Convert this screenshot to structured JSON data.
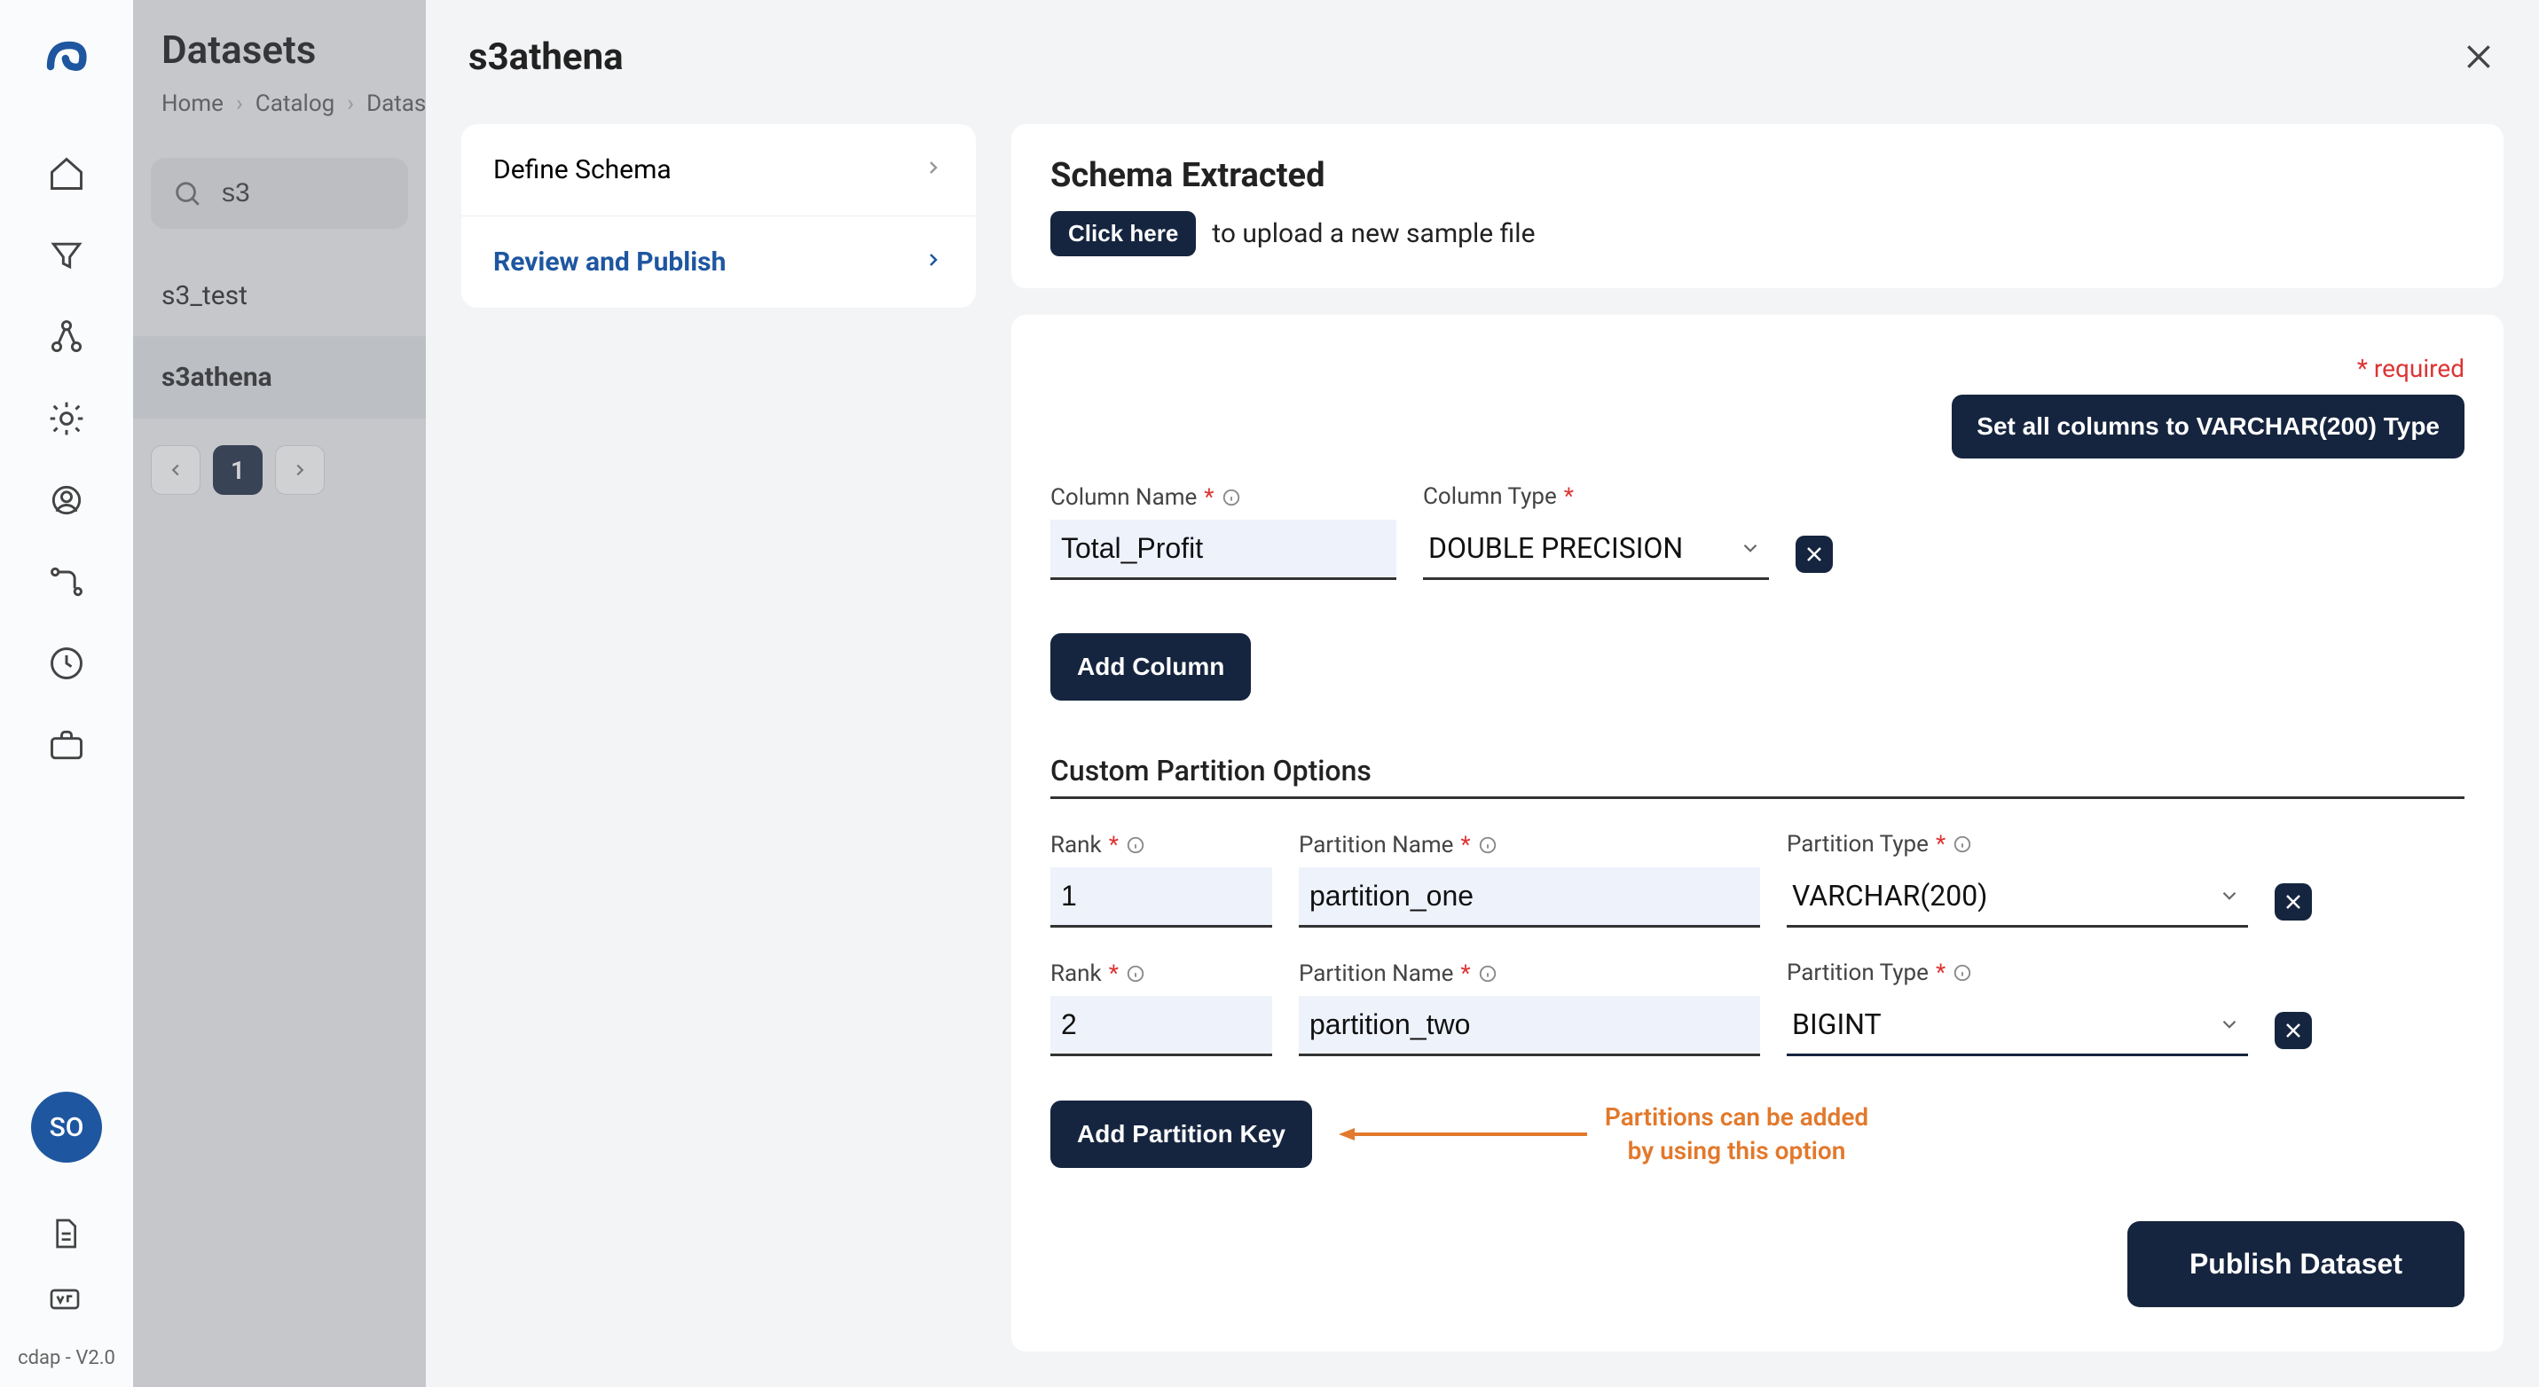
{
  "version_label": "cdap - V2.0",
  "avatar_initials": "SO",
  "ds_panel": {
    "title": "Datasets",
    "breadcrumb": [
      "Home",
      "Catalog",
      "Datasets"
    ],
    "search_value": "s3",
    "items": [
      {
        "label": "s3_test",
        "active": false
      },
      {
        "label": "s3athena",
        "active": true
      }
    ],
    "page_current": "1"
  },
  "modal": {
    "title": "s3athena",
    "steps": [
      {
        "label": "Define Schema",
        "active": false
      },
      {
        "label": "Review and Publish",
        "active": true
      }
    ],
    "schema": {
      "heading": "Schema Extracted",
      "chip": "Click here",
      "upload_text": "to upload a new sample file"
    },
    "form": {
      "required_hint": "* required",
      "set_all_label": "Set all columns to VARCHAR(200) Type",
      "column": {
        "name_label": "Column Name",
        "type_label": "Column Type",
        "name_value": "Total_Profit",
        "type_value": "DOUBLE PRECISION"
      },
      "add_column_label": "Add Column",
      "partition_section": "Custom Partition Options",
      "labels": {
        "rank": "Rank",
        "pname": "Partition Name",
        "ptype": "Partition Type"
      },
      "partitions": [
        {
          "rank": "1",
          "name": "partition_one",
          "type": "VARCHAR(200)"
        },
        {
          "rank": "2",
          "name": "partition_two",
          "type": "BIGINT"
        }
      ],
      "add_partition_label": "Add Partition Key",
      "annotation_line1": "Partitions can be added",
      "annotation_line2": "by using this option",
      "publish_label": "Publish Dataset"
    }
  }
}
